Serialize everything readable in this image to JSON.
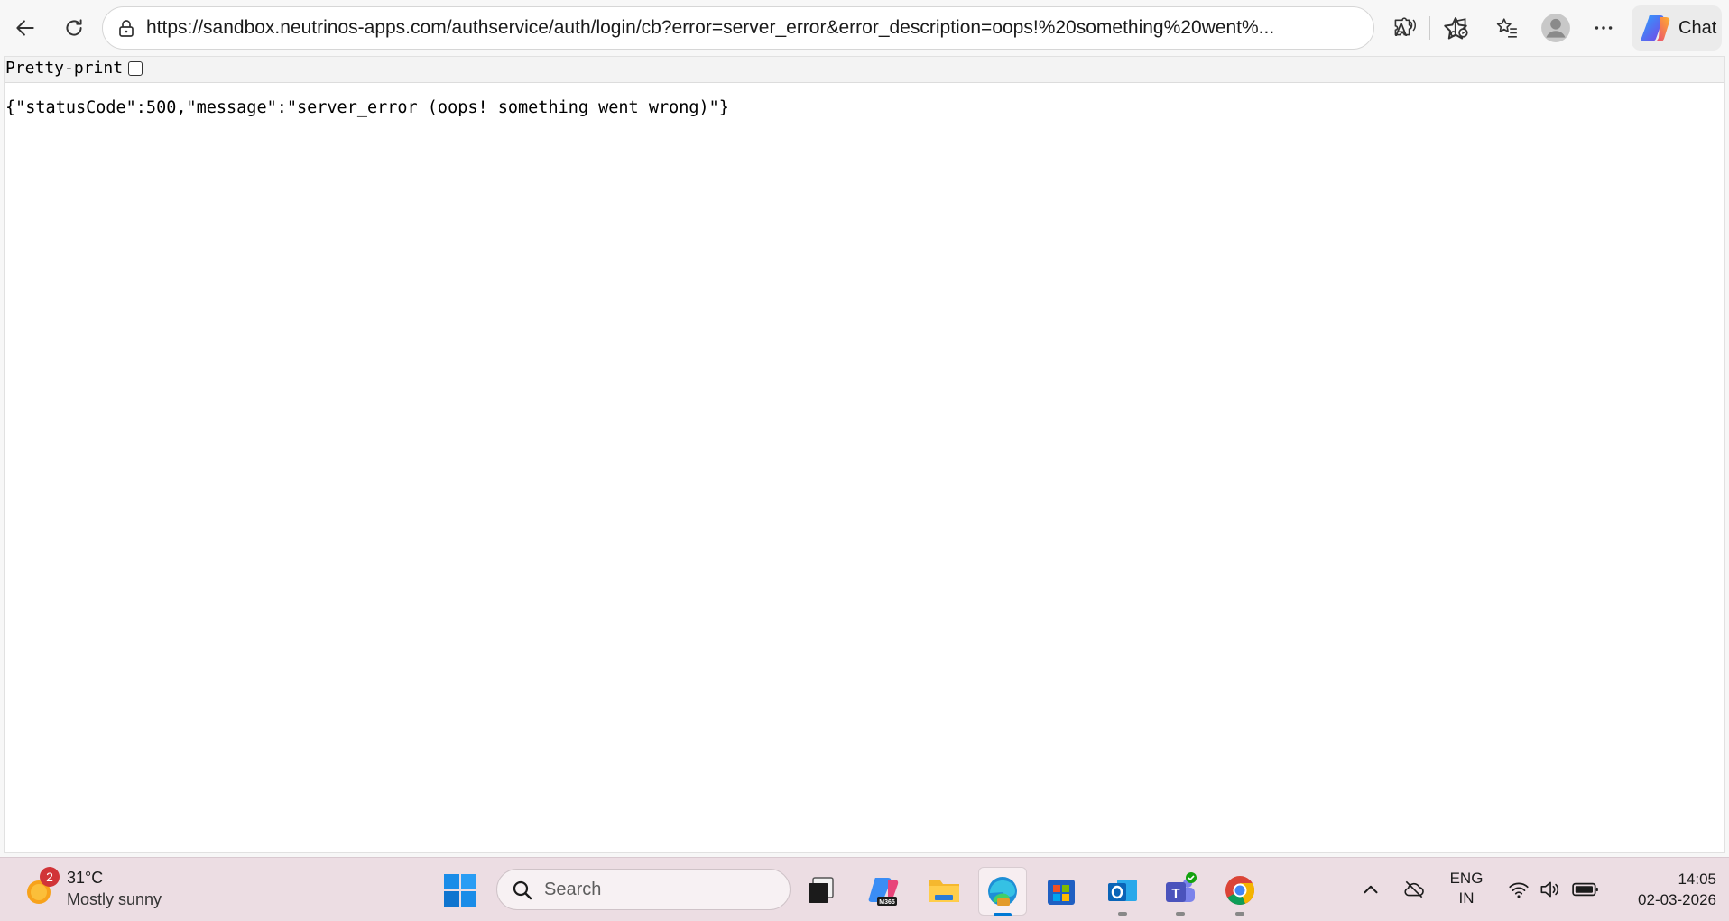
{
  "browser": {
    "url": "https://sandbox.neutrinos-apps.com/authservice/auth/login/cb?error=server_error&error_description=oops!%20something%20went%...",
    "chat_label": "Chat"
  },
  "page": {
    "pretty_print_label": "Pretty-print",
    "pretty_print_checked": false,
    "json_text": "{\"statusCode\":500,\"message\":\"server_error (oops! something went wrong)\"}"
  },
  "taskbar": {
    "weather": {
      "badge": "2",
      "temp": "31°C",
      "condition": "Mostly sunny"
    },
    "search_placeholder": "Search",
    "lang_line1": "ENG",
    "lang_line2": "IN",
    "time": "14:05",
    "date": "02-03-2026"
  },
  "colors": {
    "accent": "#0078d4",
    "taskbar_bg": "#ecdde3"
  }
}
